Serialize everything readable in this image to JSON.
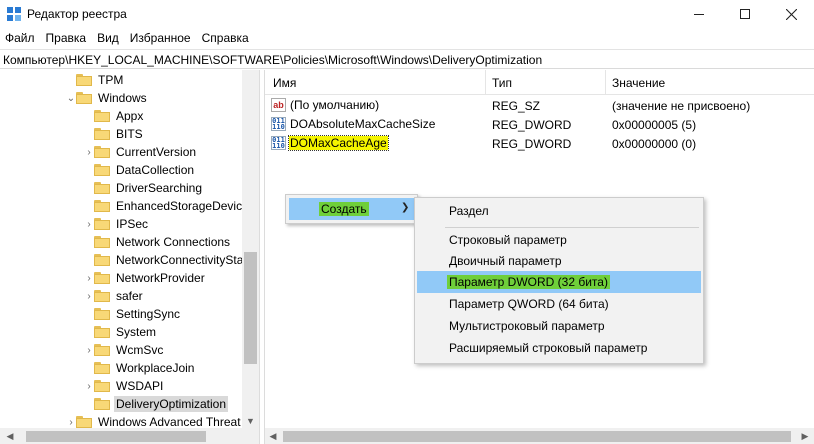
{
  "window": {
    "title": "Редактор реестра",
    "icon": "registry-editor-icon"
  },
  "menubar": [
    "Файл",
    "Правка",
    "Вид",
    "Избранное",
    "Справка"
  ],
  "address": "Компьютер\\HKEY_LOCAL_MACHINE\\SOFTWARE\\Policies\\Microsoft\\Windows\\DeliveryOptimization",
  "tree": {
    "items": [
      {
        "label": "TPM",
        "expandable": false
      },
      {
        "label": "Windows",
        "expandable": true,
        "expanded": true
      },
      {
        "label": "Appx",
        "expandable": false
      },
      {
        "label": "BITS",
        "expandable": false
      },
      {
        "label": "CurrentVersion",
        "expandable": true
      },
      {
        "label": "DataCollection",
        "expandable": false
      },
      {
        "label": "DriverSearching",
        "expandable": false
      },
      {
        "label": "EnhancedStorageDevice",
        "expandable": false
      },
      {
        "label": "IPSec",
        "expandable": true
      },
      {
        "label": "Network Connections",
        "expandable": false
      },
      {
        "label": "NetworkConnectivitySta",
        "expandable": false
      },
      {
        "label": "NetworkProvider",
        "expandable": true
      },
      {
        "label": "safer",
        "expandable": true
      },
      {
        "label": "SettingSync",
        "expandable": false
      },
      {
        "label": "System",
        "expandable": false
      },
      {
        "label": "WcmSvc",
        "expandable": true
      },
      {
        "label": "WorkplaceJoin",
        "expandable": false
      },
      {
        "label": "WSDAPI",
        "expandable": true
      },
      {
        "label": "DeliveryOptimization",
        "expandable": false,
        "selected": true
      },
      {
        "label": "Windows Advanced Threat",
        "expandable": true
      }
    ]
  },
  "values": {
    "columns": {
      "name": "Имя",
      "type": "Тип",
      "data": "Значение"
    },
    "rows": [
      {
        "icon": "string-value-icon",
        "name": "(По умолчанию)",
        "type": "REG_SZ",
        "data": "(значение не присвоено)"
      },
      {
        "icon": "dword-value-icon",
        "name": "DOAbsoluteMaxCacheSize",
        "type": "REG_DWORD",
        "data": "0x00000005 (5)"
      },
      {
        "icon": "dword-value-icon",
        "name": "DOMaxCacheAge",
        "type": "REG_DWORD",
        "data": "0x00000000 (0)",
        "highlighted": true
      }
    ]
  },
  "context_menu": {
    "create_label": "Создать",
    "submenu": {
      "key": "Раздел",
      "string": "Строковый параметр",
      "binary": "Двоичный параметр",
      "dword": "Параметр DWORD (32 бита)",
      "qword": "Параметр QWORD (64 бита)",
      "multi_string": "Мультистроковый параметр",
      "expandable_string": "Расширяемый строковый параметр"
    }
  },
  "colors": {
    "menu_hover": "#91c9f7",
    "marker_green": "#6fcf3a",
    "marker_yellow": "#f5f500",
    "folder": "#f8d877"
  }
}
